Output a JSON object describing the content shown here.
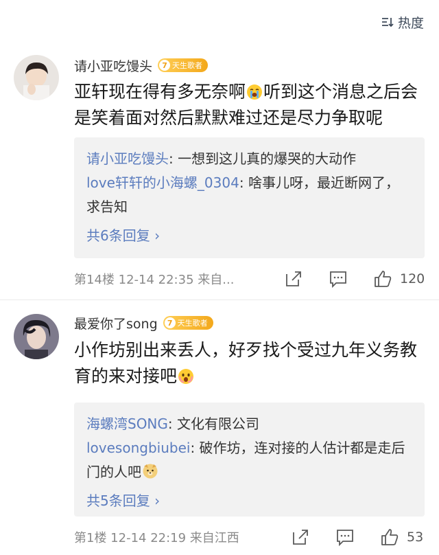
{
  "sort": {
    "label": "热度"
  },
  "comments": [
    {
      "username": "请小亚吃馒头",
      "badge_level": "7",
      "badge_text": "天生歌者",
      "text_before_emoji": "亚轩现在得有多无奈啊",
      "text_after_emoji": "听到这个消息之后会是笑着面对然后默默难过还是尽力争取呢",
      "emoji": "crying-face",
      "replies": [
        {
          "name": "请小亚吃馒头",
          "text": ": 一想到这儿真的爆哭的大动作"
        },
        {
          "name": "love轩轩的小海螺_0304",
          "text": ": 啥事儿呀，最近断网了，求告知"
        }
      ],
      "more": "共6条回复",
      "meta": "第14楼 12-14 22:35 来自...",
      "likes": "120"
    },
    {
      "username": "最爱你了song",
      "badge_level": "7",
      "badge_text": "天生歌者",
      "text_before_emoji": "小作坊别出来丢人，好歹找个受过九年义务教育的来对接吧",
      "text_after_emoji": "",
      "emoji": "fearful-face",
      "replies": [
        {
          "name": "海螺湾SONG",
          "text": ": 文化有限公司"
        },
        {
          "name": "lovesongbiubei",
          "text": ": 破作坊，连对接的人估计都是走后门的人吧",
          "emoji": "doge-face"
        }
      ],
      "more": "共5条回复",
      "meta": "第1楼 12-14 22:19 来自江西",
      "likes": "53"
    }
  ],
  "colors": {
    "link": "#5b7cbe",
    "badge": "#f3a81b",
    "reply_bg": "#f2f2f2"
  }
}
